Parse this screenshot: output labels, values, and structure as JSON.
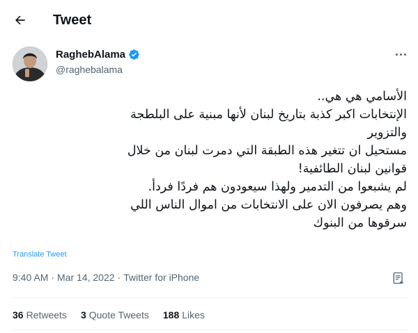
{
  "header": {
    "title": "Tweet",
    "back_icon": "arrow-left-icon"
  },
  "author": {
    "name": "RaghebAlama",
    "handle": "@raghebalama",
    "verified_color": "#1d9bf0"
  },
  "tweet": {
    "lines": [
      "الأسامي هي هي..",
      "الإنتخابات اكبر كذبة بتاريخ لبنان لأنها مبنية على البلطجة",
      "والتزوير",
      "مستحيل ان تتغير هذه الطبقة التي دمرت لبنان من خلال",
      "قوانين لبنان الطائفية!",
      "لم يشبعوا من التدمير ولهذا سيعودون هم فردًا فردأ.",
      "وهم يصرفون الان على الانتخابات من اموال الناس اللي",
      "سرقوها من البنوك"
    ],
    "translate_label": "Translate Tweet",
    "time": "9:40 AM",
    "separator": "·",
    "date": "Mar 14, 2022",
    "source": "Twitter for iPhone"
  },
  "stats": {
    "retweets_count": "36",
    "retweets_label": "Retweets",
    "quotes_count": "3",
    "quotes_label": "Quote Tweets",
    "likes_count": "188",
    "likes_label": "Likes"
  },
  "colors": {
    "accent": "#1d9bf0",
    "text": "#0f1419",
    "muted": "#536471"
  }
}
